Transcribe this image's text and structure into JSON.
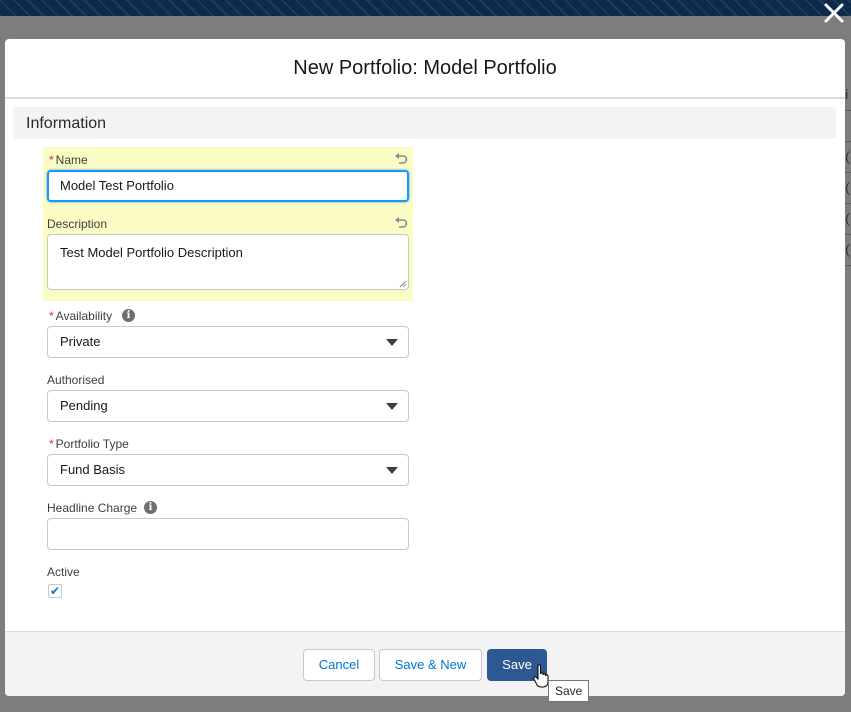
{
  "modal": {
    "title": "New Portfolio: Model Portfolio",
    "close_icon": "close-icon"
  },
  "section": {
    "title": "Information"
  },
  "fields": {
    "name": {
      "label": "Name",
      "value": "Model Test Portfolio",
      "required": "*"
    },
    "description": {
      "label": "Description",
      "value": "Test Model Portfolio Description"
    },
    "availability": {
      "label": "Availability",
      "value": "Private",
      "required": "*"
    },
    "authorised": {
      "label": "Authorised",
      "value": "Pending"
    },
    "portfolio_type": {
      "label": "Portfolio Type",
      "value": "Fund Basis",
      "required": "*"
    },
    "headline_charge": {
      "label": "Headline Charge",
      "value": ""
    },
    "active": {
      "label": "Active",
      "checked": true,
      "check_glyph": "✔"
    }
  },
  "footer": {
    "cancel_label": "Cancel",
    "save_new_label": "Save & New",
    "save_label": "Save"
  },
  "tooltip": {
    "text": "Save"
  },
  "background": {
    "row_glyphs": [
      "ni",
      "d",
      "2(",
      "2(",
      "2(",
      "2("
    ]
  },
  "colors": {
    "brand": "#2e5891",
    "focus": "#1b96ff",
    "highlight": "#fbfbc4",
    "required": "#c23934",
    "link": "#0176d3"
  }
}
